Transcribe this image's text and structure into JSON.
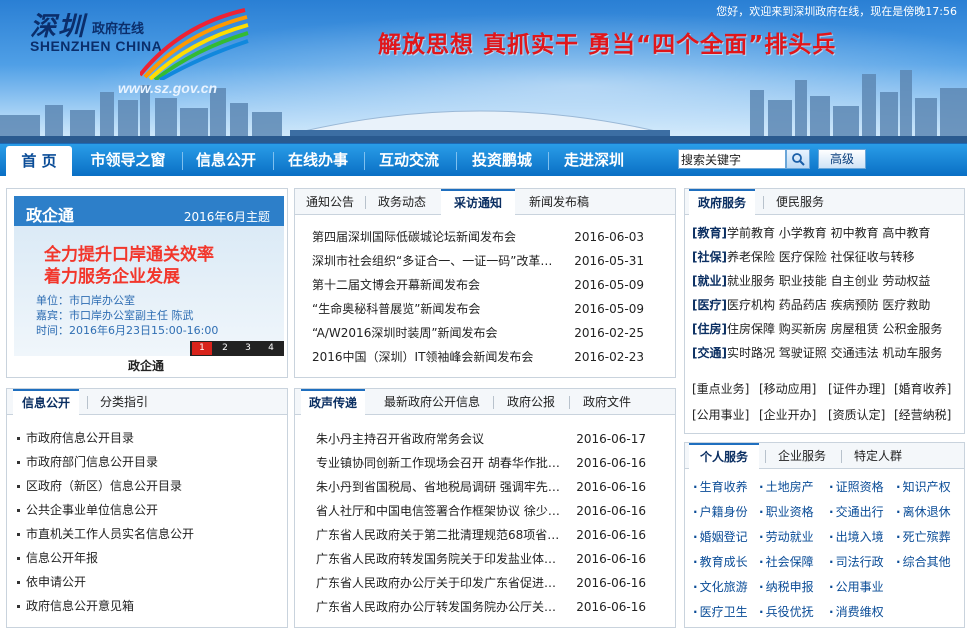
{
  "header": {
    "logo_cn": "深圳",
    "logo_cn2": "政府在线",
    "logo_en": "SHENZHEN CHINA",
    "url": "www.sz.gov.cn",
    "welcome": "您好，欢迎来到深圳政府在线，现在是傍晚17:56",
    "slogan": "解放思想 真抓实干 勇当“四个全面”排头兵"
  },
  "nav": {
    "items": [
      "首 页",
      "市领导之窗",
      "信息公开",
      "在线办事",
      "互动交流",
      "投资鹏城",
      "走进深圳"
    ],
    "search_value": "搜索关键字",
    "advanced_label": "高级"
  },
  "zqt": {
    "title": "政企通",
    "date_theme": "2016年6月主题",
    "headline1": "全力提升口岸通关效率",
    "headline2": "着力服务企业发展",
    "unit": "单位：市口岸办公室",
    "guest": "嘉宾：市口岸办公室副主任   陈武",
    "time": "时间：2016年6月23日15:00-16:00",
    "pages": [
      "1",
      "2",
      "3",
      "4"
    ],
    "caption": "政企通"
  },
  "news1": {
    "tabs": [
      "通知公告",
      "政务动态",
      "采访通知",
      "新闻发布稿"
    ],
    "rows": [
      {
        "title": "第四届深圳国际低碳城论坛新闻发布会",
        "date": "2016-06-03"
      },
      {
        "title": "深圳市社会组织“多证合一、一证一码”改革…",
        "date": "2016-05-31"
      },
      {
        "title": "第十二届文博会开幕新闻发布会",
        "date": "2016-05-09"
      },
      {
        "title": "“生命奥秘科普展览”新闻发布会",
        "date": "2016-05-09"
      },
      {
        "title": "“A/W2016深圳时装周”新闻发布会",
        "date": "2016-02-25"
      },
      {
        "title": "2016中国（深圳）IT领袖峰会新闻发布会",
        "date": "2016-02-23"
      }
    ]
  },
  "info": {
    "tabs": [
      "信息公开",
      "分类指引"
    ],
    "items": [
      "市政府信息公开目录",
      "市政府部门信息公开目录",
      "区政府（新区）信息公开目录",
      "公共企事业单位信息公开",
      "市直机关工作人员实名信息公开",
      "信息公开年报",
      "依申请公开",
      "政府信息公开意见箱"
    ]
  },
  "news2": {
    "tabs": [
      "政声传递",
      "最新政府公开信息",
      "政府公报",
      "政府文件"
    ],
    "rows": [
      {
        "title": "朱小丹主持召开省政府常务会议",
        "date": "2016-06-17"
      },
      {
        "title": "专业镇协同创新工作现场会召开 胡春华作批示…",
        "date": "2016-06-16"
      },
      {
        "title": "朱小丹到省国税局、省地税局调研 强调牢先完…",
        "date": "2016-06-16"
      },
      {
        "title": "省人社厅和中国电信签署合作框架协议 徐少华…",
        "date": "2016-06-16"
      },
      {
        "title": "广东省人民政府关于第二批清理规范68项省政…",
        "date": "2016-06-16"
      },
      {
        "title": "广东省人民政府转发国务院关于印发盐业体制…",
        "date": "2016-06-16"
      },
      {
        "title": "广东省人民政府办公厅关于印发广东省促进社…",
        "date": "2016-06-16"
      },
      {
        "title": "广东省人民政府办公厅转发国务院办公厅关于…",
        "date": "2016-06-16"
      }
    ]
  },
  "gov_service": {
    "tabs": [
      "政府服务",
      "便民服务"
    ],
    "rows": [
      {
        "cat": "[教育]",
        "items": "学前教育 小学教育 初中教育 高中教育"
      },
      {
        "cat": "[社保]",
        "items": "养老保险 医疗保险 社保征收与转移"
      },
      {
        "cat": "[就业]",
        "items": "就业服务 职业技能 自主创业 劳动权益"
      },
      {
        "cat": "[医疗]",
        "items": "医疗机构 药品药店 疾病预防 医疗救助"
      },
      {
        "cat": "[住房]",
        "items": "住房保障 购买新房 房屋租赁 公积金服务"
      },
      {
        "cat": "[交通]",
        "items": "实时路况 驾驶证照 交通违法 机动车服务"
      }
    ],
    "tags1": [
      "[重点业务]",
      "[移动应用]",
      "[证件办理]",
      "[婚育收养]"
    ],
    "tags2": [
      "[公用事业]",
      "[企业开办]",
      "[资质认定]",
      "[经营纳税]"
    ]
  },
  "personal": {
    "tabs": [
      "个人服务",
      "企业服务",
      "特定人群"
    ],
    "items": [
      "生育收养",
      "土地房产",
      "证照资格",
      "知识产权",
      "户籍身份",
      "职业资格",
      "交通出行",
      "离休退休",
      "婚姻登记",
      "劳动就业",
      "出境入境",
      "死亡殡葬",
      "教育成长",
      "社会保障",
      "司法行政",
      "综合其他",
      "文化旅游",
      "纳税申报",
      "公用事业",
      "",
      "医疗卫生",
      "兵役优抚",
      "消费维权",
      ""
    ]
  }
}
